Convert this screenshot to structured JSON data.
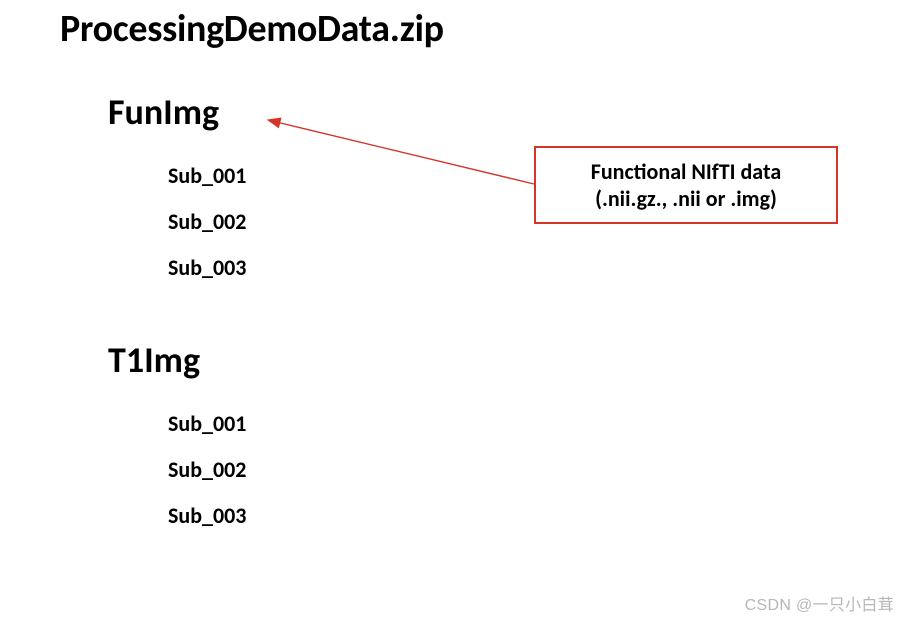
{
  "title": "ProcessingDemoData.zip",
  "dirs": [
    {
      "name": "FunImg",
      "children": [
        "Sub_001",
        "Sub_002",
        "Sub_003"
      ]
    },
    {
      "name": "T1Img",
      "children": [
        "Sub_001",
        "Sub_002",
        "Sub_003"
      ]
    }
  ],
  "annotation": {
    "line1": "Functional NIfTI data",
    "line2": "(.nii.gz., .nii or .img)"
  },
  "watermark": "CSDN @一只小白茸"
}
